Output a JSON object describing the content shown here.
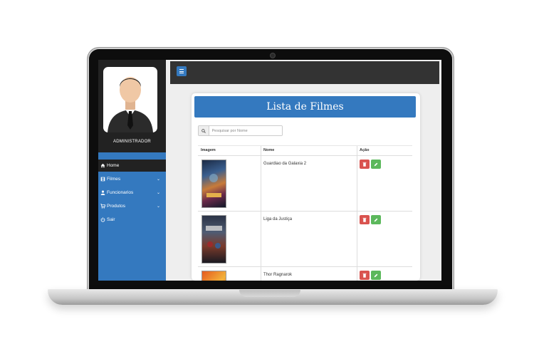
{
  "sidebar": {
    "user_label": "ADMINISTRADOR",
    "items": [
      {
        "label": "Home",
        "icon": "home-icon"
      },
      {
        "label": "Filmes",
        "icon": "film-icon"
      },
      {
        "label": "Funcionarios",
        "icon": "user-icon"
      },
      {
        "label": "Produtos",
        "icon": "cart-icon"
      },
      {
        "label": "Sair",
        "icon": "power-icon"
      }
    ]
  },
  "panel": {
    "title": "Lista de Filmes",
    "search_placeholder": "Pesquisar por Nome"
  },
  "table": {
    "headers": [
      "Imagem",
      "Nome",
      "Ação"
    ],
    "rows": [
      {
        "name": "Guardiao da Galaxia 2"
      },
      {
        "name": "Liga da Justiça"
      },
      {
        "name": "Thor Ragnarok"
      }
    ]
  },
  "colors": {
    "accent": "#3479bf",
    "sidebar_dark": "#222222",
    "topbar": "#333333",
    "delete": "#d9534f",
    "edit": "#5cb85c"
  }
}
